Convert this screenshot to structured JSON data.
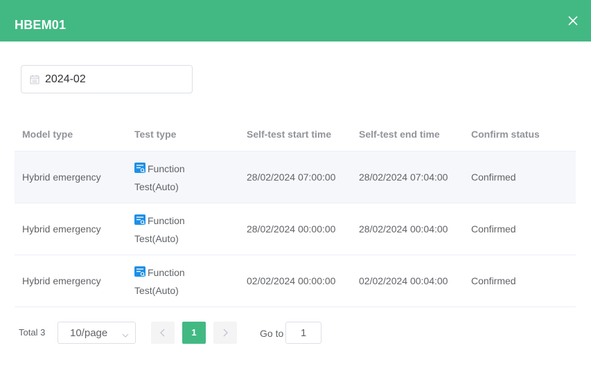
{
  "dialog": {
    "title": "HBEM01",
    "close_icon": "close-icon"
  },
  "date_filter": {
    "icon": "calendar-icon",
    "value": "2024-02"
  },
  "table": {
    "columns": [
      "Model type",
      "Test type",
      "Self-test start time",
      "Self-test end time",
      "Confirm status"
    ],
    "test_icon": "function-test-icon",
    "rows": [
      {
        "model_type": "Hybrid emergency",
        "test_type": "Function Test(Auto)",
        "start": "28/02/2024 07:00:00",
        "end": "28/02/2024 07:04:00",
        "status": "Confirmed"
      },
      {
        "model_type": "Hybrid emergency",
        "test_type": "Function Test(Auto)",
        "start": "28/02/2024 00:00:00",
        "end": "28/02/2024 00:04:00",
        "status": "Confirmed"
      },
      {
        "model_type": "Hybrid emergency",
        "test_type": "Function Test(Auto)",
        "start": "02/02/2024 00:00:00",
        "end": "02/02/2024 00:04:00",
        "status": "Confirmed"
      }
    ]
  },
  "pagination": {
    "total_label": "Total 3",
    "page_size": "10/page",
    "current_page": "1",
    "goto_label": "Go to",
    "goto_value": "1"
  },
  "colors": {
    "accent": "#42b983",
    "icon_blue": "#1e90e6"
  }
}
